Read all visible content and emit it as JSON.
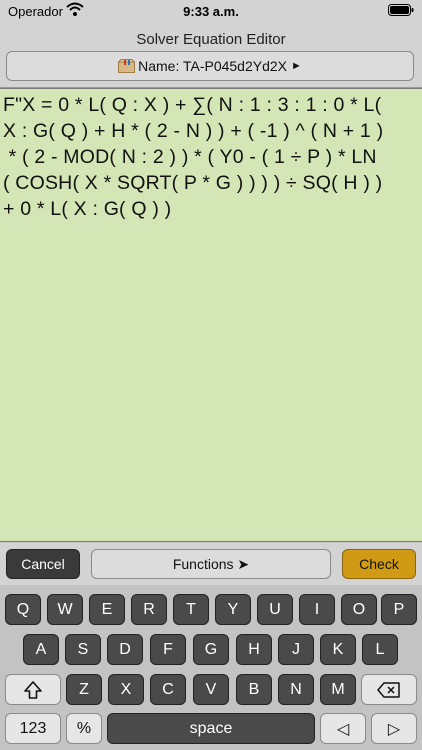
{
  "status": {
    "carrier": "Operador",
    "time": "9:33 a.m."
  },
  "header": {
    "title": "Solver Equation Editor",
    "name_label": "Name: TA-P045d2Yd2X",
    "name_arrow": "►"
  },
  "equation": {
    "lines": [
      "F\"X = 0 * L( Q : X ) + ∑( N : 1 : 3 : 1 : 0 * L(",
      "X : G( Q ) + H * ( 2 - N ) ) + ( -1 ) ^ ( N + 1 )",
      " * ( 2 - MOD( N : 2 ) ) * ( Y0 - ( 1 ÷ P ) * LN",
      "( COSH( X * SQRT( P * G ) ) ) ) ÷ SQ( H ) )",
      "+ 0 * L( X : G( Q ) )"
    ]
  },
  "toolbar": {
    "cancel": "Cancel",
    "functions": "Functions ➤",
    "check": "Check"
  },
  "keyboard": {
    "row1": [
      "Q",
      "W",
      "E",
      "R",
      "T",
      "Y",
      "U",
      "I",
      "O",
      "P"
    ],
    "row2": [
      "A",
      "S",
      "D",
      "F",
      "G",
      "H",
      "J",
      "K",
      "L"
    ],
    "row3": [
      "Z",
      "X",
      "C",
      "V",
      "B",
      "N",
      "M"
    ],
    "row4": {
      "numbers": "123",
      "percent": "%",
      "space": "space",
      "left": "◁",
      "right": "▷"
    }
  },
  "colors": {
    "editor_bg": "#d4e6b5",
    "check_bg": "#d19a14",
    "dark_key": "#4a4a4a"
  }
}
